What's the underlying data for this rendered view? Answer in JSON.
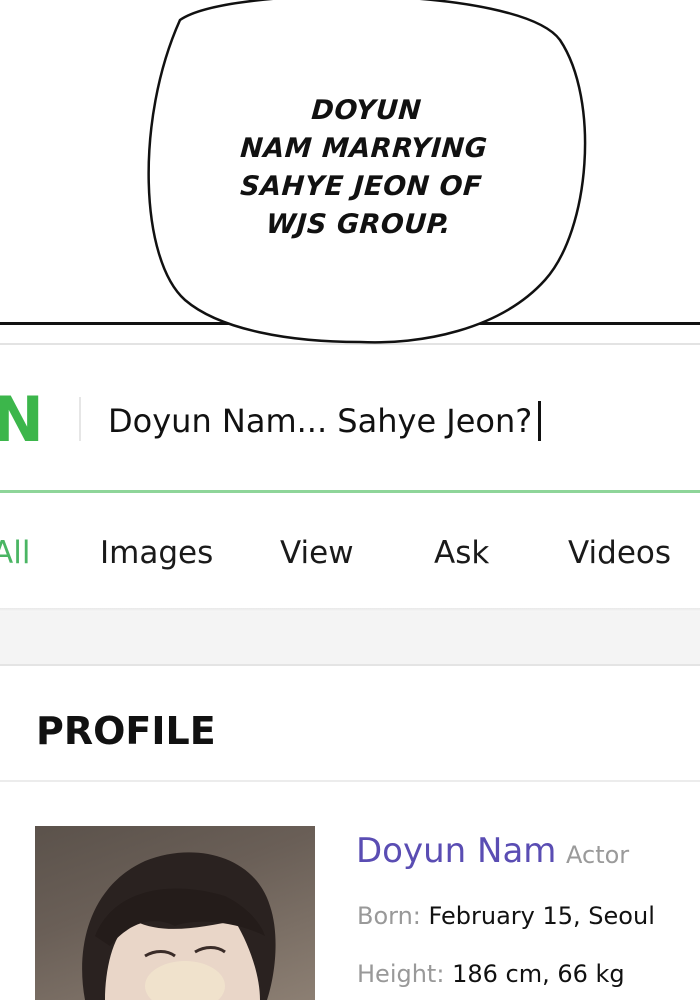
{
  "comic": {
    "speech_lines": [
      "DOYUN",
      "NAM MARRYING",
      "SAHYE JEON OF",
      "WJS GROUP."
    ]
  },
  "app": {
    "logo_text": "N",
    "brand_color": "#3cb64b"
  },
  "search": {
    "value": "Doyun Nam... Sahye Jeon?"
  },
  "tabs": [
    {
      "label": "All",
      "active": true
    },
    {
      "label": "Images",
      "active": false
    },
    {
      "label": "View",
      "active": false
    },
    {
      "label": "Ask",
      "active": false
    },
    {
      "label": "Videos",
      "active": false
    }
  ],
  "profile": {
    "section_title": "PROFILE",
    "name": "Doyun Nam",
    "role": "Actor",
    "born_label": "Born:",
    "born_value": "February 15, Seoul",
    "height_label": "Height:",
    "height_value": "186 cm, 66 kg"
  },
  "colors": {
    "active_tab": "#4ab563",
    "name_link": "#5a4db3",
    "search_underline": "#8ed599"
  }
}
